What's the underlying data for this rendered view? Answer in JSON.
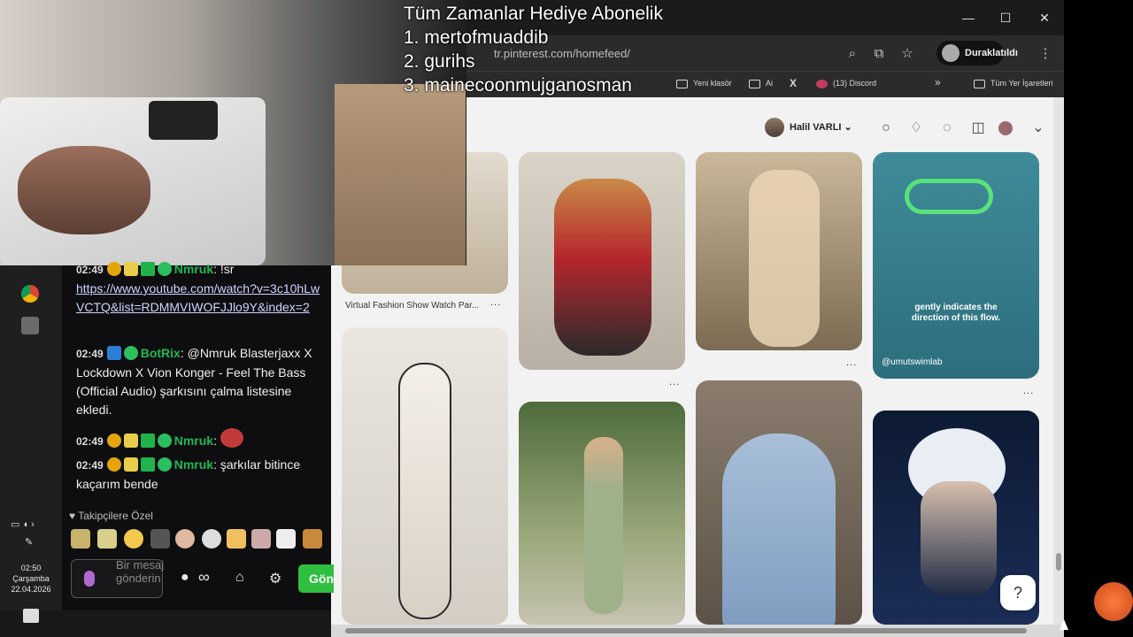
{
  "overlay": {
    "title": "Tüm Zamanlar Hediye  Abonelik",
    "line1": "1. mertofmuaddib",
    "line2": "2. gurihs",
    "line3": "3. mainecoonmujganosman"
  },
  "browser": {
    "url": "tr.pinterest.com/homefeed/",
    "profile_label": "Duraklatıldı",
    "window_controls": [
      "minimize-icon",
      "maximize-icon",
      "close-icon"
    ],
    "bookmarks": [
      {
        "label": "Yeni klasör"
      },
      {
        "label": "Ai"
      },
      {
        "label": "X"
      },
      {
        "label": "(13) Discord"
      }
    ],
    "bookmarks_all": "Tüm Yer İşaretleri"
  },
  "pinterest": {
    "user_name": "Halil VARLI",
    "pin_caption": "Virtual Fashion Show Watch Par...",
    "pin_text_line1": "gently indicates the",
    "pin_text_line2": "direction of this flow.",
    "pin_watermark": "@umutswimlab",
    "more": "...",
    "help": "?"
  },
  "chat": {
    "messages": [
      {
        "time": "02:49",
        "user": "Nmruk",
        "text": "!sr",
        "link": "https://www.youtube.com/watch?v=3c10hLwVCTQ&list=RDMMVIWOFJJlo9Y&index=2"
      },
      {
        "time": "02:49",
        "user": "BotRix",
        "text": "@Nmruk Blasterjaxx X Lockdown X Vion Konger - Feel The Bass (Official Audio) şarkısını çalma listesine ekledi."
      },
      {
        "time": "02:49",
        "user": "Nmruk",
        "text": ""
      },
      {
        "time": "02:49",
        "user": "Nmruk",
        "text": "şarkılar bitince kaçarım bende"
      }
    ],
    "followers_only": "Takipçilere Özel",
    "input_placeholder": "Bir mesaj gönderin",
    "send_label": "Gönder",
    "infinity": "∞"
  },
  "taskbar": {
    "time": "02:50",
    "day": "Çarşamba",
    "date": "22.04.2026"
  }
}
